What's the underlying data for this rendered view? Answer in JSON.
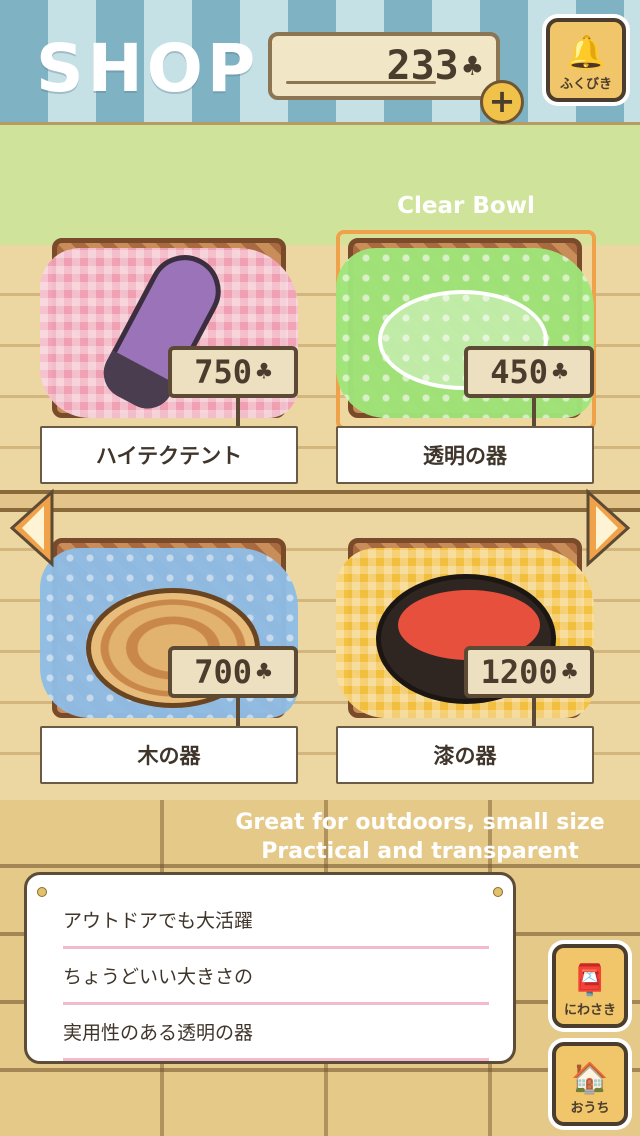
{
  "header": {
    "title": "SHOP",
    "currency_amount": "233",
    "currency_symbol": "♣",
    "add_label": "+",
    "lottery_label": "ふくびき"
  },
  "selected_item": {
    "english_name": "Clear Bowl"
  },
  "items": [
    {
      "name": "ハイテクテント",
      "price": "750",
      "cloth_color": "#f3a2b8"
    },
    {
      "name": "透明の器",
      "price": "450",
      "cloth_color": "#9fe67a"
    },
    {
      "name": "木の器",
      "price": "700",
      "cloth_color": "#8fbde6"
    },
    {
      "name": "漆の器",
      "price": "1200",
      "cloth_color": "#f5c23e"
    }
  ],
  "description": {
    "english_line1": "Great for outdoors, small size",
    "english_line2": "Practical and transparent",
    "lines": [
      "アウトドアでも大活躍",
      "ちょうどいい大きさの",
      "実用性のある透明の器"
    ]
  },
  "side_buttons": {
    "yard_label": "にわさき",
    "home_label": "おうち"
  },
  "colors": {
    "awning_blue": "#7fb3c4",
    "awning_light": "#c6e1e6",
    "button_yellow": "#f1c66a",
    "accent_orange": "#f0a24a"
  },
  "icons": {
    "lottery": "handbell-icon",
    "yard": "mailbox-icon",
    "home": "house-icon",
    "nav_left": "left-arrow-icon",
    "nav_right": "right-arrow-icon"
  }
}
